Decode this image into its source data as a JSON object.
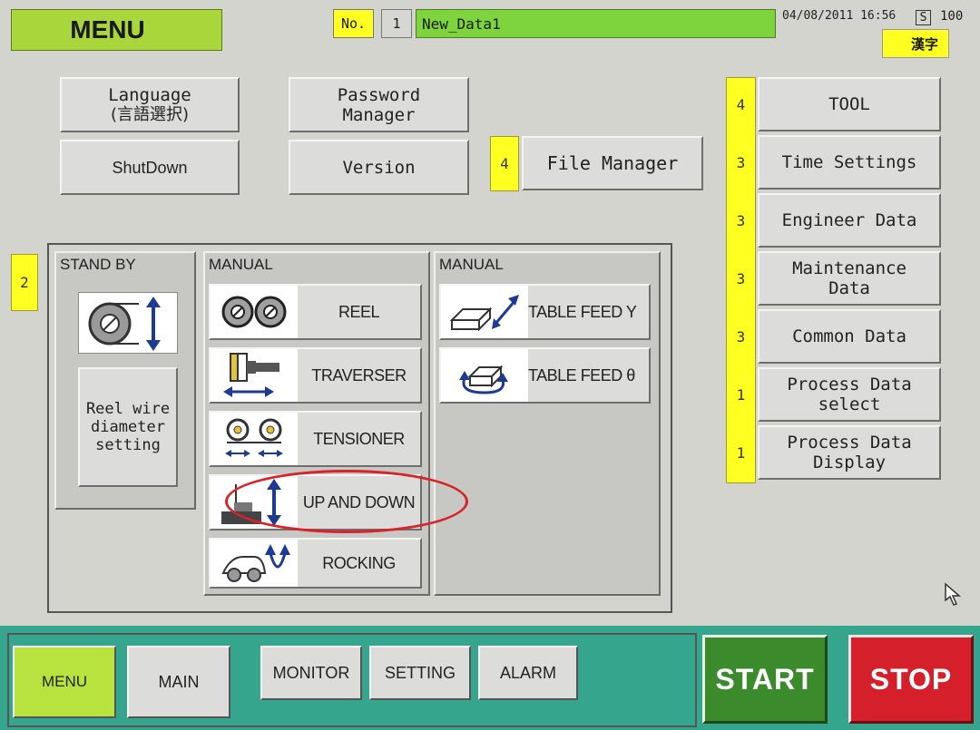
{
  "header": {
    "title": "MENU",
    "no_label": "No.",
    "no_value": "1",
    "data_name": "New_Data1",
    "datetime": "04/08/2011 16:56",
    "s_label": "S",
    "s_value": "100",
    "lang_chars": "漢字"
  },
  "top_buttons": {
    "language_line1": "Language",
    "language_line2": "(言語選択)",
    "password_line1": "Password",
    "password_line2": "Manager",
    "shutdown": "ShutDown",
    "version": "Version",
    "file_manager": "File Manager",
    "file_manager_level": "4"
  },
  "right_menu": [
    {
      "level": "4",
      "line1": "TOOL",
      "line2": ""
    },
    {
      "level": "3",
      "line1": "Time Settings",
      "line2": ""
    },
    {
      "level": "3",
      "line1": "Engineer Data",
      "line2": ""
    },
    {
      "level": "3",
      "line1": "Maintenance",
      "line2": "Data"
    },
    {
      "level": "3",
      "line1": "Common Data",
      "line2": ""
    },
    {
      "level": "1",
      "line1": "Process Data",
      "line2": "select"
    },
    {
      "level": "1",
      "line1": "Process Data",
      "line2": "Display"
    }
  ],
  "panel": {
    "level": "2",
    "standby_header": "STAND BY",
    "reel_wire_line1": "Reel wire",
    "reel_wire_line2": "diameter",
    "reel_wire_line3": "setting",
    "manual1_header": "MANUAL",
    "manual2_header": "MANUAL",
    "manual1_items": [
      "REEL",
      "TRAVERSER",
      "TENSIONER",
      "UP AND DOWN",
      "ROCKING"
    ],
    "manual2_items": [
      "TABLE FEED Y",
      "TABLE FEED θ"
    ]
  },
  "bottom": {
    "menu": "MENU",
    "main": "MAIN",
    "monitor": "MONITOR",
    "setting": "SETTING",
    "alarm": "ALARM",
    "start": "START",
    "stop": "STOP"
  },
  "colors": {
    "menu_title_bg": "#a9d63a",
    "data_name_bg": "#7dd43c",
    "level_box": "#ffff22",
    "bottom_bar": "#36a58e",
    "start_bg": "#3b8a2c",
    "stop_bg": "#d5202b",
    "highlight_circle": "#d8232a"
  }
}
